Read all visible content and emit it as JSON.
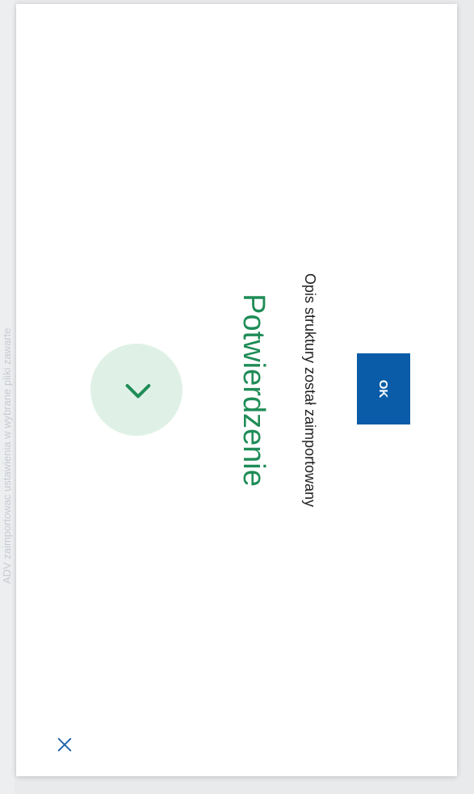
{
  "background": {
    "partial_text": "ADV zaimportowac ustawienia w wybrane pliki zawarte"
  },
  "dialog": {
    "close_icon": "close-icon",
    "status_icon": "chevron-right-icon",
    "title": "Potwierdzenie",
    "message": "Opis struktury został zaimportowany",
    "ok_label": "OK"
  },
  "colors": {
    "accent_green": "#1f8c57",
    "icon_circle_bg": "#dff1e7",
    "primary_button": "#0a5ca8",
    "close_icon": "#1f5fa8"
  }
}
